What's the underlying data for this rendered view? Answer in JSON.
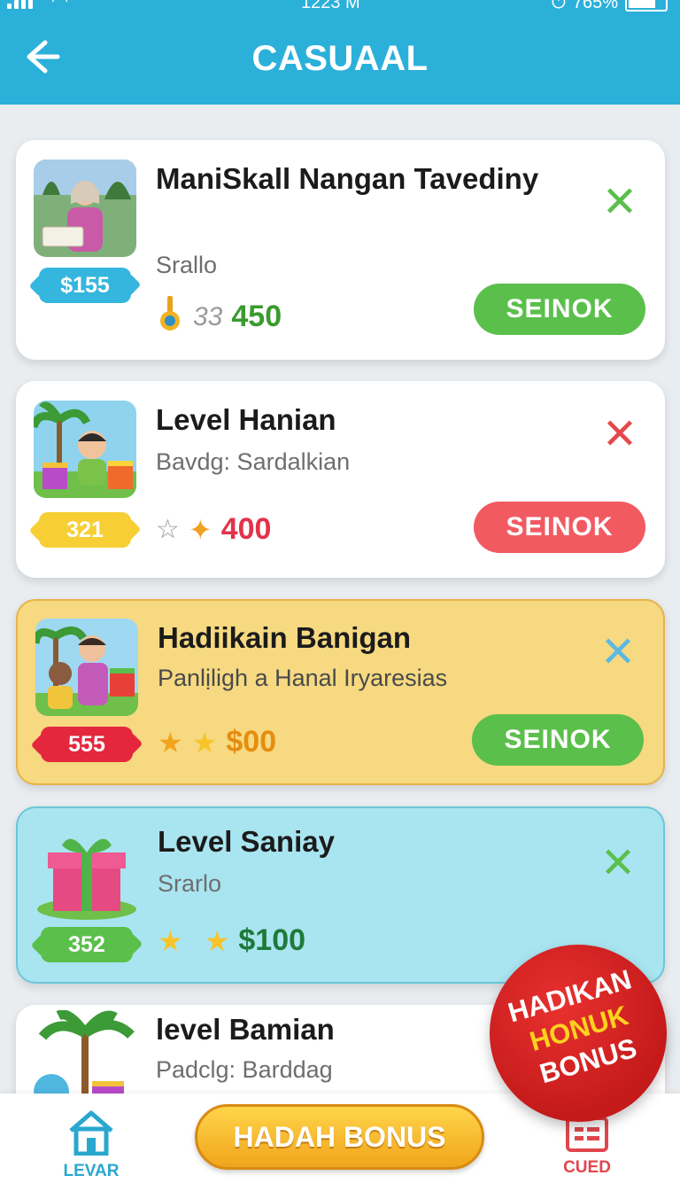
{
  "status_bar": {
    "time": "1223 M",
    "battery": "765%"
  },
  "header": {
    "title": "CASUAAL",
    "back_icon": "back-arrow-icon"
  },
  "cards": [
    {
      "title": "ManiSkall Nangan Tavediny",
      "subtitle": "Srallo",
      "price": "$155",
      "reward_strike": "33",
      "reward_amount": "450",
      "action": "SEINOK",
      "thumb_icon": "person-photo-icon",
      "close_color": "#5bbf4c"
    },
    {
      "title": "Level Hanian",
      "subtitle": "Bavdg: Sardalkian",
      "price": "321",
      "reward_amount": "400",
      "action": "SEINOK",
      "thumb_icon": "kid-palm-gifts-icon",
      "close_color": "#e5484d"
    },
    {
      "title": "Hadiikain Banigan",
      "subtitle": "Panlịligh a Hanal Iryaresias",
      "price": "555",
      "reward_amount": "$00",
      "action": "SEINOK",
      "thumb_icon": "kids-palm-gifts-icon",
      "close_color": "#5bb9e3"
    },
    {
      "title": "Level Saniay",
      "subtitle": "Srarlo",
      "price": "352",
      "reward_amount": "$100",
      "thumb_icon": "gift-box-icon",
      "close_color": "#5bbf4c"
    },
    {
      "title": "level Bamian",
      "subtitle": "Padclg: Barddag",
      "thumb_icon": "palm-tree-icon"
    }
  ],
  "bonus_badge": {
    "line1": "HADIKAN",
    "line2": "HONUK",
    "line3": "BONUS"
  },
  "bottom_nav": {
    "home_label": "LEVAR",
    "bonus_button": "HADAH BONUS",
    "cued_label": "CUED"
  },
  "colors": {
    "header": "#2bb0da",
    "green": "#5bbf4c",
    "red": "#e5484d",
    "yellow_card": "#f6d981",
    "cyan_card": "#a9e5f1"
  }
}
